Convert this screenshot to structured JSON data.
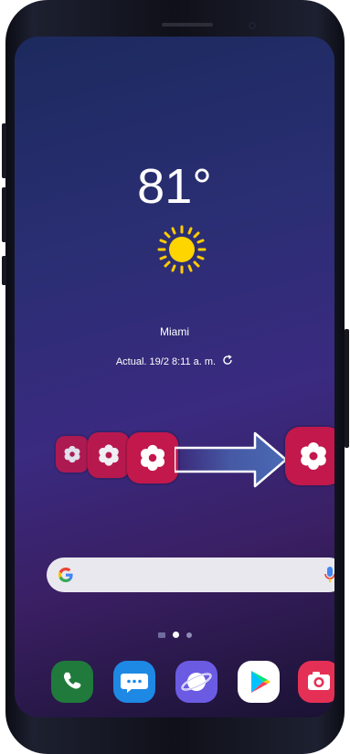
{
  "weather": {
    "temperature": "81°",
    "city": "Miami",
    "updated": "Actual. 19/2 8:11 a. m."
  },
  "search": {
    "placeholder": ""
  },
  "page_indicator": {
    "pages": 2,
    "current": 1
  },
  "dock": [
    {
      "name": "phone",
      "icon": "phone-icon"
    },
    {
      "name": "messages",
      "icon": "messages-icon"
    },
    {
      "name": "internet",
      "icon": "internet-icon"
    },
    {
      "name": "play-store",
      "icon": "play-store-icon"
    },
    {
      "name": "camera",
      "icon": "camera-icon"
    }
  ],
  "navigation": {
    "recent": "|||",
    "home": "○",
    "back": "<"
  },
  "colors": {
    "tile": "#c2184b",
    "arrow": "#4a6ab5",
    "sun": "#ffcc00"
  }
}
